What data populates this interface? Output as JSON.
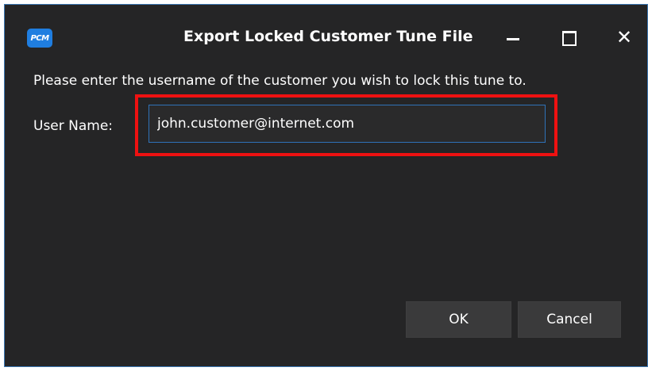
{
  "window": {
    "title": "Export Locked Customer Tune File",
    "app_icon_text": "PCM",
    "accent_color": "#1f7ee0"
  },
  "window_controls": {
    "minimize_icon": "minimize-icon",
    "maximize_icon": "maximize-icon",
    "close_icon": "close-icon",
    "close_glyph": "✕"
  },
  "dialog": {
    "prompt": "Please enter the username of the customer you wish to lock this tune to.",
    "username_label": "User Name:",
    "username_value": "john.customer@internet.com",
    "highlight_color": "#ee1111"
  },
  "buttons": {
    "ok_label": "OK",
    "cancel_label": "Cancel"
  }
}
